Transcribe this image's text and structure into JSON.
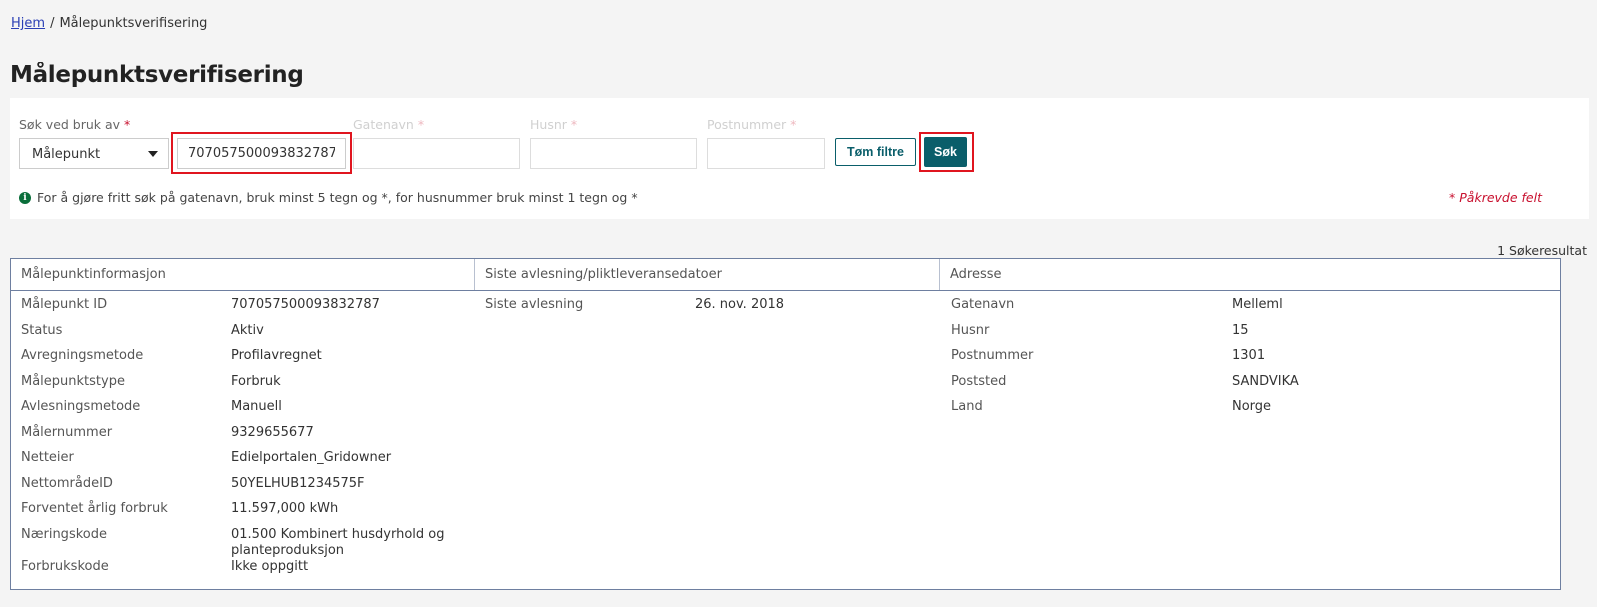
{
  "breadcrumb": {
    "home": "Hjem",
    "separator": "/",
    "current": "Målepunktsverifisering"
  },
  "page_title": "Målepunktsverifisering",
  "search": {
    "search_by_label": "Søk ved bruk av",
    "required_mark": "*",
    "search_by_value": "Målepunkt",
    "main_input_value": "707057500093832787",
    "street_label": "Gatenavn",
    "house_label": "Husnr",
    "postal_label": "Postnummer",
    "clear_button": "Tøm filtre",
    "search_button": "Søk",
    "info_text": "For å gjøre fritt søk på gatenavn, bruk minst 5 tegn og *, for husnummer bruk minst 1 tegn og *",
    "required_note": "* Påkrevde felt"
  },
  "result_count": "1 Søkeresultat",
  "results": {
    "headers": [
      "Målepunktinformasjon",
      "Siste avlesning/pliktleveransedatoer",
      "Adresse"
    ],
    "meter_info": [
      {
        "label": "Målepunkt ID",
        "value": "707057500093832787"
      },
      {
        "label": "Status",
        "value": "Aktiv"
      },
      {
        "label": "Avregningsmetode",
        "value": "Profilavregnet"
      },
      {
        "label": "Målepunktstype",
        "value": "Forbruk"
      },
      {
        "label": "Avlesningsmetode",
        "value": "Manuell"
      },
      {
        "label": "Målernummer",
        "value": "9329655677"
      },
      {
        "label": "Netteier",
        "value": "Edielportalen_Gridowner"
      },
      {
        "label": "NettområdeID",
        "value": "50YELHUB1234575F"
      },
      {
        "label": "Forventet årlig forbruk",
        "value": "11.597,000 kWh"
      },
      {
        "label": "Næringskode",
        "value": "01.500 Kombinert husdyrhold og",
        "value2": "planteproduksjon"
      },
      {
        "label": "Forbrukskode",
        "value": "Ikke oppgitt"
      }
    ],
    "reading": [
      {
        "label": "Siste avlesning",
        "value": "26. nov. 2018"
      }
    ],
    "address": [
      {
        "label": "Gatenavn",
        "value": "Melleml"
      },
      {
        "label": "Husnr",
        "value": "15"
      },
      {
        "label": "Postnummer",
        "value": "1301"
      },
      {
        "label": "Poststed",
        "value": "SANDVIKA"
      },
      {
        "label": "Land",
        "value": "Norge"
      }
    ]
  }
}
